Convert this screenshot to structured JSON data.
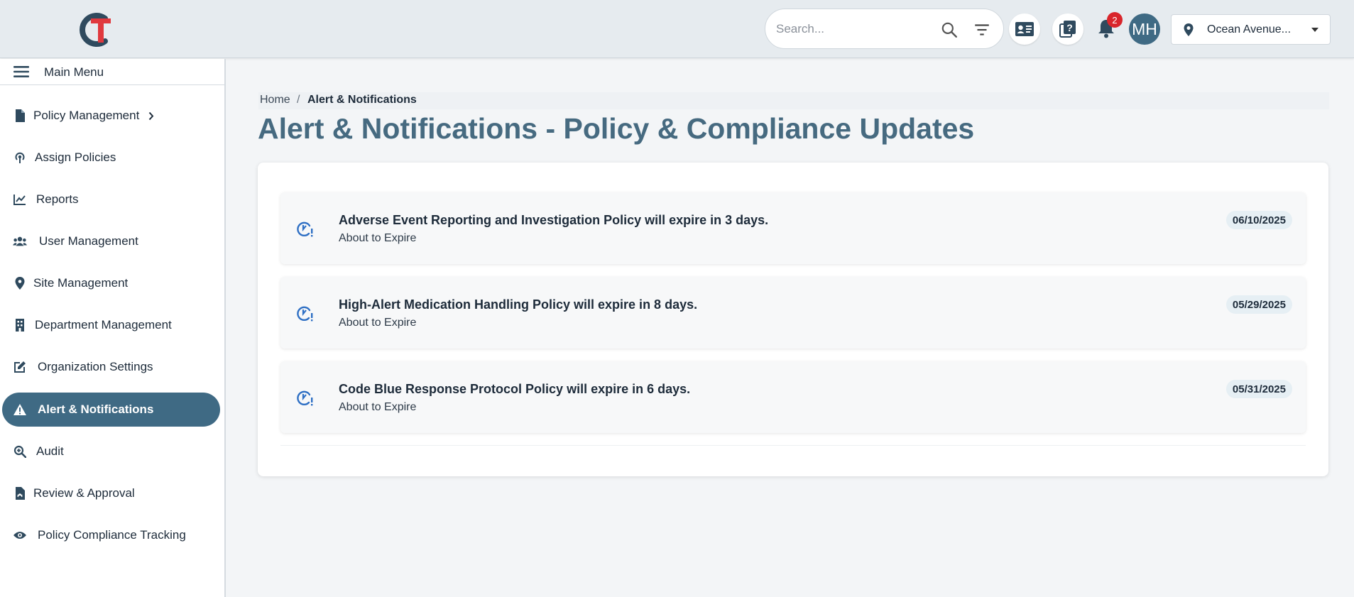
{
  "header": {
    "search": {
      "placeholder": "Search..."
    },
    "notification_count": "2",
    "avatar_initials": "MH",
    "site_selector": {
      "value": "Ocean Avenue..."
    },
    "icons": [
      "search-icon",
      "filter-icon",
      "id-card-icon",
      "help-icon",
      "bell-icon",
      "location-pin-icon",
      "chevron-down-icon"
    ]
  },
  "sidebar": {
    "main_menu_label": "Main Menu",
    "items": [
      {
        "label": "Policy Management",
        "icon": "file-icon"
      },
      {
        "label": "Assign Policies",
        "icon": "podcast-icon"
      },
      {
        "label": "Reports",
        "icon": "chart-line-icon"
      },
      {
        "label": "User Management",
        "icon": "users-icon"
      },
      {
        "label": "Site Management",
        "icon": "location-pin-icon"
      },
      {
        "label": "Department Management",
        "icon": "building-icon"
      },
      {
        "label": "Organization Settings",
        "icon": "edit-icon"
      },
      {
        "label": "Alert & Notifications",
        "icon": "warning-icon",
        "active": true
      },
      {
        "label": "Audit",
        "icon": "search-plus-icon"
      },
      {
        "label": "Review & Approval",
        "icon": "file-pdf-icon"
      },
      {
        "label": "Policy Compliance Tracking",
        "icon": "eye-icon"
      }
    ]
  },
  "breadcrumb": {
    "home": "Home",
    "separator": "/",
    "current": "Alert & Notifications"
  },
  "page_title": "Alert & Notifications - Policy & Compliance Updates",
  "alerts": [
    {
      "title": "Adverse Event Reporting and Investigation Policy will expire in 3 days.",
      "status": "About to Expire",
      "date": "06/10/2025"
    },
    {
      "title": "High-Alert Medication Handling Policy will expire in 8 days.",
      "status": "About to Expire",
      "date": "05/29/2025"
    },
    {
      "title": "Code Blue Response Protocol Policy will expire in 6 days.",
      "status": "About to Expire",
      "date": "05/31/2025"
    }
  ],
  "colors": {
    "accent": "#3f6a84",
    "title": "#466a80",
    "badge": "#d9252b",
    "alert_icon": "#2e6fc4"
  }
}
